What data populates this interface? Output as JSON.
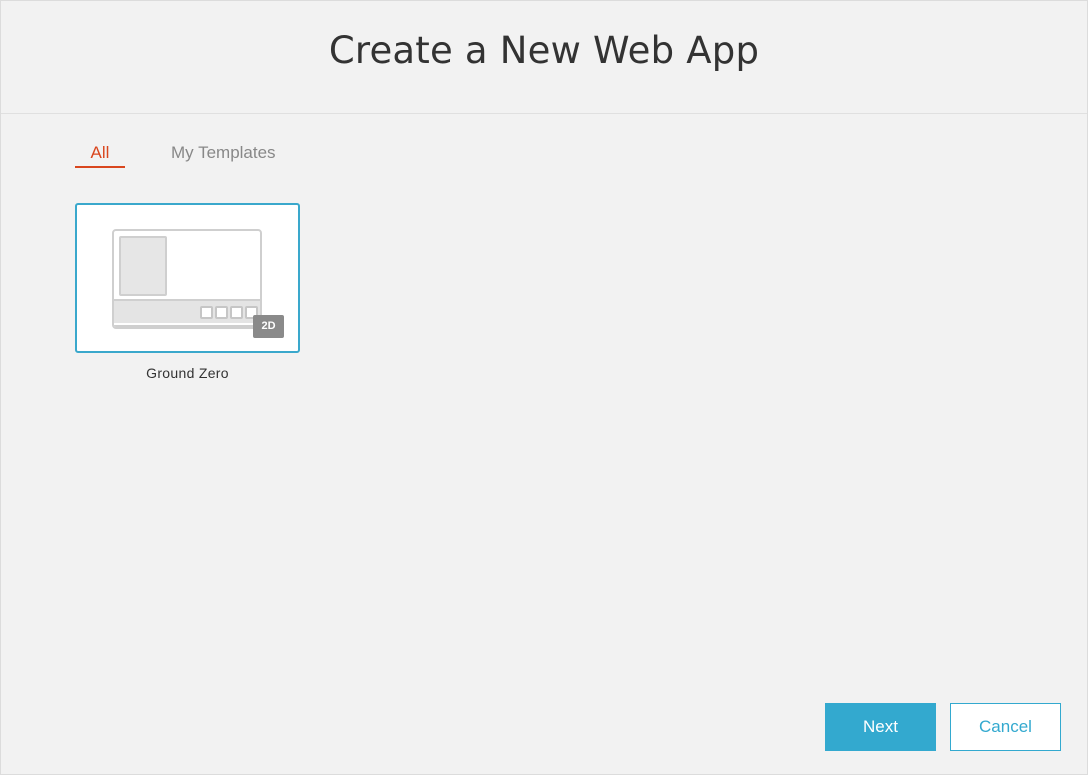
{
  "dialog": {
    "title": "Create a New Web App"
  },
  "tabs": [
    {
      "label": "All",
      "active": true
    },
    {
      "label": "My Templates",
      "active": false
    }
  ],
  "templates": [
    {
      "name": "Ground Zero",
      "badge": "2D",
      "selected": true
    }
  ],
  "actions": {
    "next_label": "Next",
    "cancel_label": "Cancel"
  },
  "colors": {
    "accent": "#33a9cf",
    "active_tab": "#d9461e",
    "background": "#f2f2f2"
  }
}
